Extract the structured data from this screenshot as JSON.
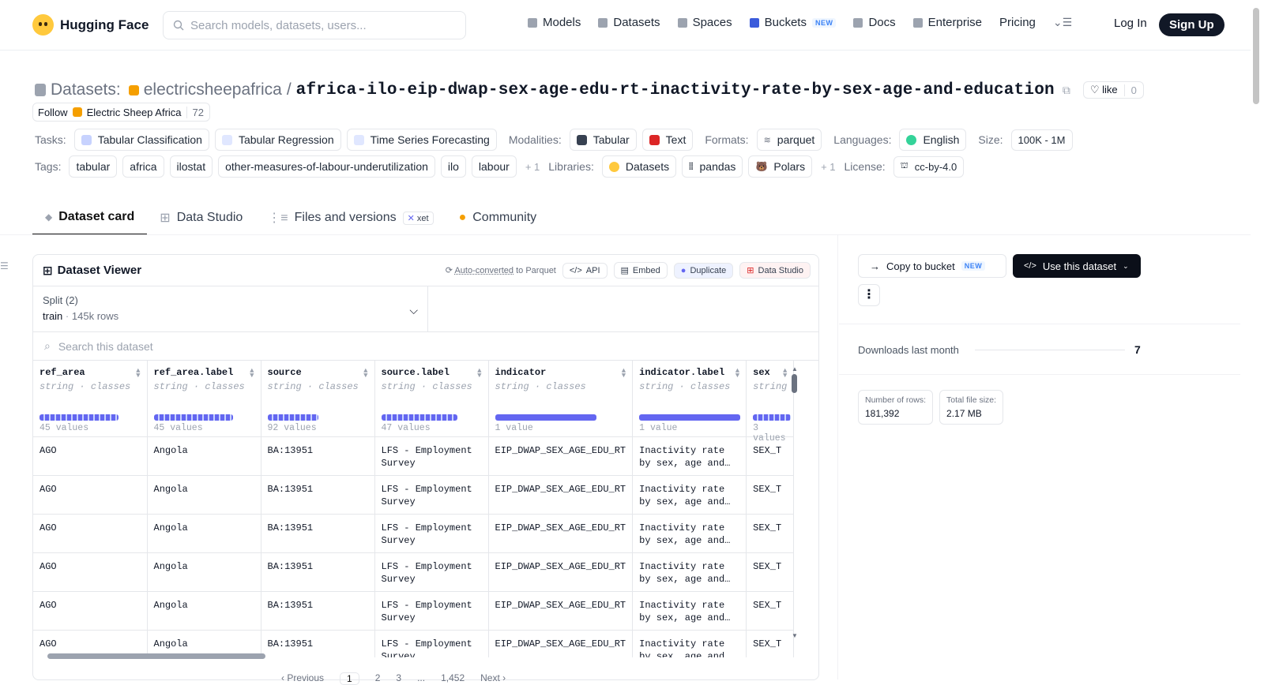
{
  "header": {
    "brand": "Hugging Face",
    "search_placeholder": "Search models, datasets, users...",
    "nav": [
      "Models",
      "Datasets",
      "Spaces",
      "Buckets",
      "Docs",
      "Enterprise",
      "Pricing"
    ],
    "new_badge": "NEW",
    "login": "Log In",
    "signup": "Sign Up"
  },
  "repo": {
    "section": "Datasets:",
    "owner": "electricsheepafrica",
    "sep": "/",
    "name": "africa-ilo-eip-dwap-sex-age-edu-rt-inactivity-rate-by-sex-age-and-education",
    "like_label": "like",
    "like_count": "0",
    "follow_label": "Follow",
    "org_name": "Electric Sheep Africa",
    "followers": "72"
  },
  "meta": {
    "tasks_label": "Tasks:",
    "tasks": [
      "Tabular Classification",
      "Tabular Regression",
      "Time Series Forecasting"
    ],
    "modalities_label": "Modalities:",
    "modalities": [
      "Tabular",
      "Text"
    ],
    "formats_label": "Formats:",
    "formats": [
      "parquet"
    ],
    "languages_label": "Languages:",
    "languages": [
      "English"
    ],
    "size_label": "Size:",
    "size": "100K - 1M",
    "tags_label": "Tags:",
    "tags": [
      "tabular",
      "africa",
      "ilostat",
      "other-measures-of-labour-underutilization",
      "ilo",
      "labour"
    ],
    "tags_more": "+ 1",
    "libraries_label": "Libraries:",
    "libraries": [
      "Datasets",
      "pandas",
      "Polars"
    ],
    "libraries_more": "+ 1",
    "license_label": "License:",
    "license": "cc-by-4.0"
  },
  "tabs": [
    "Dataset card",
    "Data Studio",
    "Files and versions",
    "Community"
  ],
  "xet": "xet",
  "viewer": {
    "title": "Dataset Viewer",
    "auto": "Auto-converted",
    "auto_rest": "to Parquet",
    "api": "API",
    "embed": "Embed",
    "duplicate": "Duplicate",
    "studio": "Data Studio",
    "split_label": "Split (2)",
    "split_value": "train",
    "split_rows": "145k rows",
    "search_placeholder": "Search this dataset",
    "columns": [
      {
        "name": "ref_area",
        "type": "string",
        "kind": "classes",
        "count": "45 values"
      },
      {
        "name": "ref_area.label",
        "type": "string",
        "kind": "classes",
        "count": "45 values"
      },
      {
        "name": "source",
        "type": "string",
        "kind": "classes",
        "count": "92 values"
      },
      {
        "name": "source.label",
        "type": "string",
        "kind": "classes",
        "count": "47 values"
      },
      {
        "name": "indicator",
        "type": "string",
        "kind": "classes",
        "count": "1 value"
      },
      {
        "name": "indicator.label",
        "type": "string",
        "kind": "classes",
        "count": "1 value"
      },
      {
        "name": "sex",
        "type": "string",
        "kind": "",
        "count": "3 values"
      }
    ],
    "row": [
      "AGO",
      "Angola",
      "BA:13951",
      "LFS - Employment Survey",
      "EIP_DWAP_SEX_AGE_EDU_RT",
      "Inactivity rate by sex, age and…",
      "SEX_T"
    ],
    "pages": [
      "Previous",
      "1",
      "2",
      "3",
      "...",
      "1,452",
      "Next"
    ]
  },
  "side": {
    "copy": "Copy to bucket",
    "use": "Use this dataset",
    "downloads_label": "Downloads last month",
    "downloads": "7",
    "rows_label": "Number of rows:",
    "rows": "181,392",
    "size_label": "Total file size:",
    "size": "2.17 MB"
  }
}
